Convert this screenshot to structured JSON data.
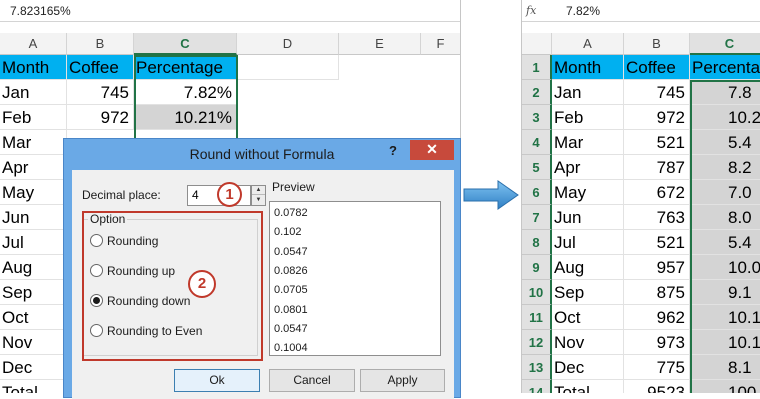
{
  "left": {
    "formula_value": "7.823165%",
    "columns": [
      "A",
      "B",
      "C",
      "D",
      "E",
      "F"
    ],
    "header_row": [
      "Month",
      "Coffee",
      "Percentage"
    ],
    "rows": [
      {
        "month": "Jan",
        "coffee": "745",
        "pct": "7.82%"
      },
      {
        "month": "Feb",
        "coffee": "972",
        "pct": "10.21%"
      },
      {
        "month": "Mar"
      },
      {
        "month": "Apr"
      },
      {
        "month": "May"
      },
      {
        "month": "Jun"
      },
      {
        "month": "Jul"
      },
      {
        "month": "Aug"
      },
      {
        "month": "Sep"
      },
      {
        "month": "Oct"
      },
      {
        "month": "Nov"
      },
      {
        "month": "Dec"
      },
      {
        "month": "Total"
      }
    ]
  },
  "right": {
    "fx_icon": "fx-icon",
    "formula_value": "7.82%",
    "columns": [
      "A",
      "B",
      "C"
    ],
    "header_row": [
      "Month",
      "Coffee",
      "Percenta"
    ],
    "row_numbers": [
      "1",
      "2",
      "3",
      "4",
      "5",
      "6",
      "7",
      "8",
      "9",
      "10",
      "11",
      "12",
      "13",
      "14"
    ],
    "rows": [
      {
        "month": "Jan",
        "coffee": "745",
        "pct": "7.8"
      },
      {
        "month": "Feb",
        "coffee": "972",
        "pct": "10.2"
      },
      {
        "month": "Mar",
        "coffee": "521",
        "pct": "5.4"
      },
      {
        "month": "Apr",
        "coffee": "787",
        "pct": "8.2"
      },
      {
        "month": "May",
        "coffee": "672",
        "pct": "7.0"
      },
      {
        "month": "Jun",
        "coffee": "763",
        "pct": "8.0"
      },
      {
        "month": "Jul",
        "coffee": "521",
        "pct": "5.4"
      },
      {
        "month": "Aug",
        "coffee": "957",
        "pct": "10.0"
      },
      {
        "month": "Sep",
        "coffee": "875",
        "pct": "9.1"
      },
      {
        "month": "Oct",
        "coffee": "962",
        "pct": "10.1"
      },
      {
        "month": "Nov",
        "coffee": "973",
        "pct": "10.1"
      },
      {
        "month": "Dec",
        "coffee": "775",
        "pct": "8.1"
      },
      {
        "month": "Total",
        "coffee": "9523",
        "pct": "100.0"
      }
    ]
  },
  "dialog": {
    "title": "Round without Formula",
    "help": "?",
    "close": "✕",
    "decimal_label": "Decimal place:",
    "decimal_value": "4",
    "option_label": "Option",
    "options": [
      "Rounding",
      "Rounding up",
      "Rounding down",
      "Rounding to Even"
    ],
    "selected_option": "Rounding down",
    "preview_label": "Preview",
    "preview_values": [
      "0.0782",
      "0.102",
      "0.0547",
      "0.0826",
      "0.0705",
      "0.0801",
      "0.0547",
      "0.1004"
    ],
    "ok": "Ok",
    "cancel": "Cancel",
    "apply": "Apply"
  },
  "badges": [
    "1",
    "2"
  ],
  "colors": {
    "header_fill": "#00b0f0",
    "excel_green": "#217346",
    "annotation_red": "#c0392b",
    "dialog_frame": "#6aa9e6"
  }
}
